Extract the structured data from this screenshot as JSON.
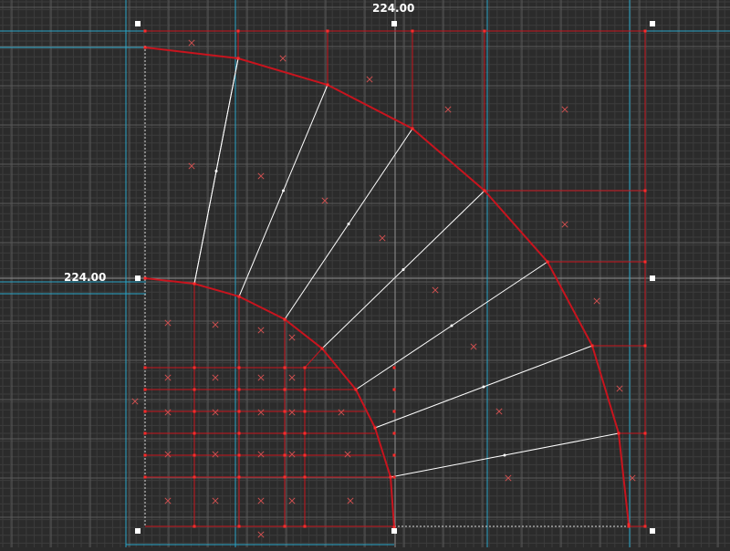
{
  "editor": {
    "dimension_width": "224.00",
    "dimension_height": "224.00"
  },
  "colors": {
    "background": "#2b2b2b",
    "grid_minor": "#3c3c3c",
    "grid_major": "#5a5a5a",
    "guide": "#2aa6c8",
    "brush_edge": "#c8141e",
    "vertex": "#ff2a2a",
    "center_mark": "#d05050",
    "spline": "#ffffff",
    "handle": "#ffffff"
  },
  "icons": {
    "center_mark": "x-mark-icon",
    "handle": "square-handle-icon",
    "vertex": "dot-vertex-icon"
  }
}
